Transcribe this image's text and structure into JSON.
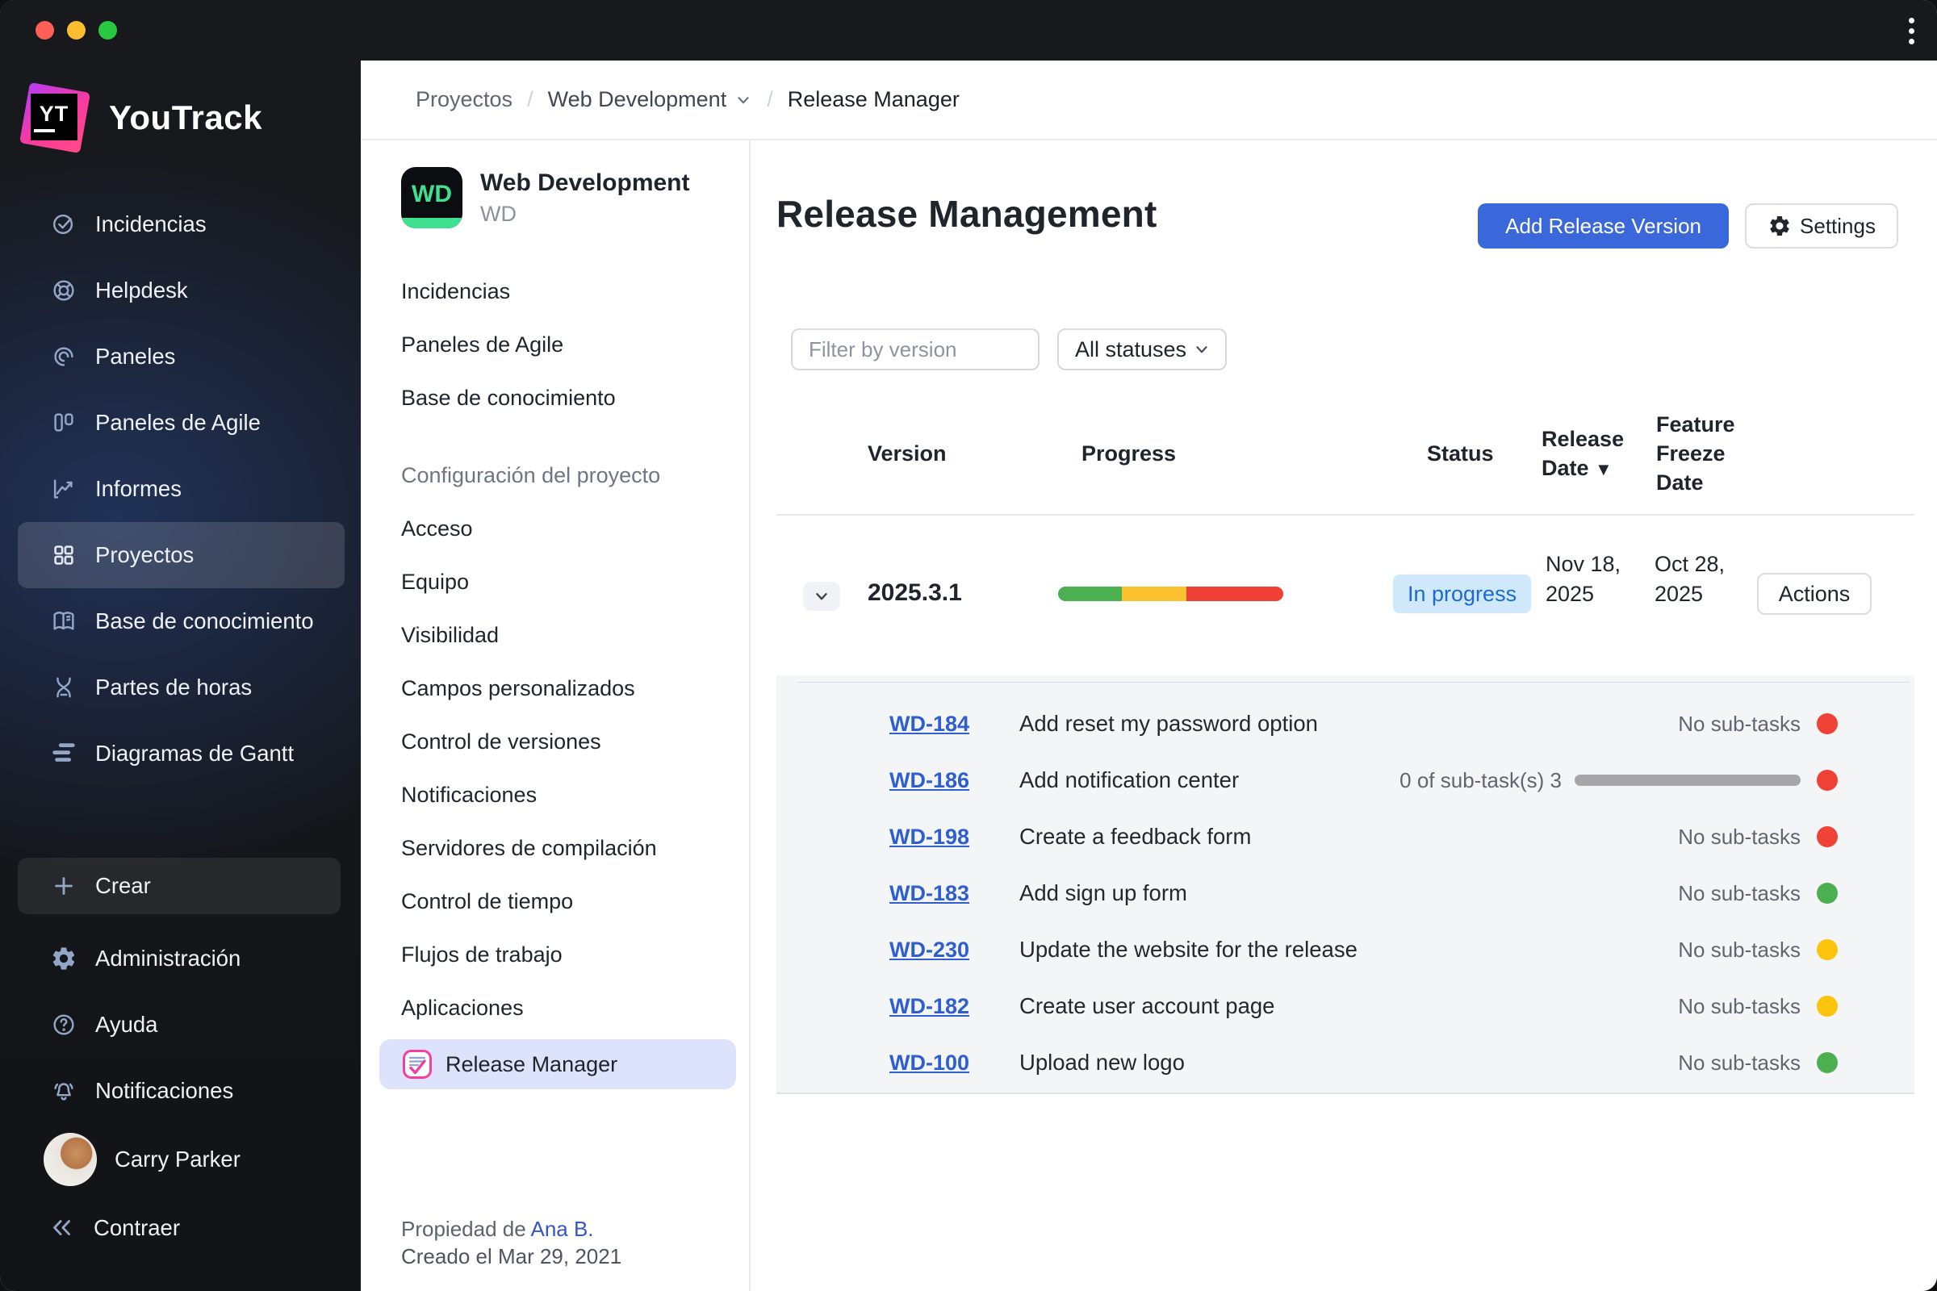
{
  "brand": {
    "name": "YouTrack",
    "logo_text": "YT"
  },
  "sidebar": {
    "items": [
      {
        "label": "Incidencias"
      },
      {
        "label": "Helpdesk"
      },
      {
        "label": "Paneles"
      },
      {
        "label": "Paneles de Agile"
      },
      {
        "label": "Informes"
      },
      {
        "label": "Proyectos"
      },
      {
        "label": "Base de conocimiento"
      },
      {
        "label": "Partes de horas"
      },
      {
        "label": "Diagramas de Gantt"
      }
    ],
    "create_label": "Crear",
    "footer_items": [
      {
        "label": "Administración"
      },
      {
        "label": "Ayuda"
      },
      {
        "label": "Notificaciones"
      }
    ],
    "user_name": "Carry Parker",
    "collapse_label": "Contraer"
  },
  "breadcrumb": {
    "root": "Proyectos",
    "separator": "/",
    "project": "Web Development",
    "current": "Release Manager"
  },
  "project_panel": {
    "avatar_text": "WD",
    "title": "Web Development",
    "subtitle": "WD",
    "menu": [
      "Incidencias",
      "Paneles de Agile",
      "Base de conocimiento"
    ],
    "section_title": "Configuración del proyecto",
    "settings_menu": [
      "Acceso",
      "Equipo",
      "Visibilidad",
      "Campos personalizados",
      "Control de versiones",
      "Notificaciones",
      "Servidores de compilación",
      "Control de tiempo",
      "Flujos de trabajo",
      "Aplicaciones"
    ],
    "active_item": "Release Manager",
    "footer": {
      "owner_label": "Propiedad de",
      "owner_name": "Ana B.",
      "created": "Creado el Mar 29, 2021"
    }
  },
  "main": {
    "title": "Release Management",
    "add_button": "Add Release Version",
    "settings_button": "Settings",
    "filter_placeholder": "Filter by version",
    "status_filter_value": "All statuses",
    "table": {
      "headers": {
        "version": "Version",
        "progress": "Progress",
        "status": "Status",
        "release_date": "Release Date",
        "feature_freeze": "Feature Freeze Date"
      },
      "sort_indicator": "▼"
    },
    "release": {
      "version": "2025.3.1",
      "status": "In progress",
      "release_date": "Nov 18, 2025",
      "freeze_date": "Oct 28, 2025",
      "actions_label": "Actions",
      "progress": [
        {
          "color": "#4caf50",
          "width": "28.3%"
        },
        {
          "color": "#fbc02d",
          "width": "28.7%"
        },
        {
          "color": "#ee4035",
          "width": "43%"
        }
      ]
    },
    "subtasks": [
      {
        "id": "WD-184",
        "title": "Add reset my password option",
        "info": "No sub-tasks",
        "dot_color": "#ef4135"
      },
      {
        "id": "WD-186",
        "title": "Add notification center",
        "info": "0 of sub-task(s) 3",
        "dot_color": "#ef4135"
      },
      {
        "id": "WD-198",
        "title": "Create a feedback form",
        "info": "No sub-tasks",
        "dot_color": "#ef4135"
      },
      {
        "id": "WD-183",
        "title": "Add sign up form",
        "info": "No sub-tasks",
        "dot_color": "#4caf50"
      },
      {
        "id": "WD-230",
        "title": "Update the website for the release",
        "info": "No sub-tasks",
        "dot_color": "#fcc40d"
      },
      {
        "id": "WD-182",
        "title": "Create user account page",
        "info": "No sub-tasks",
        "dot_color": "#fcc40d"
      },
      {
        "id": "WD-100",
        "title": "Upload new logo",
        "info": "No sub-tasks",
        "dot_color": "#4caf50"
      }
    ]
  },
  "colors": {
    "accent_blue": "#3a68da",
    "badge_bg": "#cfe9fb",
    "badge_text": "#1b6ad4",
    "status_red": "#ef4135",
    "status_yellow": "#fcc40d",
    "status_green": "#4caf50",
    "brand_pink": "#f93a9e",
    "wd_green": "#3fe08f"
  }
}
